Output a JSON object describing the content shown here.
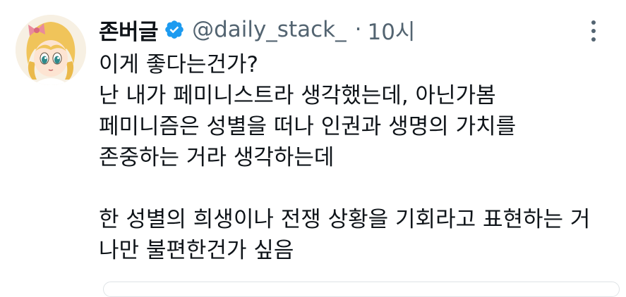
{
  "tweet": {
    "display_name": "존버글",
    "handle": "@daily_stack_",
    "separator": "·",
    "time": "10시",
    "lines": [
      "이게 좋다는건가?",
      "난 내가 페미니스트라 생각했는데, 아닌가봄",
      "페미니즘은 성별을 떠나 인권과 생명의 가치를",
      "존중하는 거라 생각하는데",
      "",
      "한 성별의 희생이나 전쟁 상황을 기회라고 표현하는 거",
      "나만 불편한건가 싶음"
    ],
    "icons": {
      "verified": "verified-badge-icon",
      "more": "more-options-icon"
    },
    "colors": {
      "verified": "#1d9bf0",
      "text": "#0f1419",
      "secondary": "#536471"
    }
  }
}
